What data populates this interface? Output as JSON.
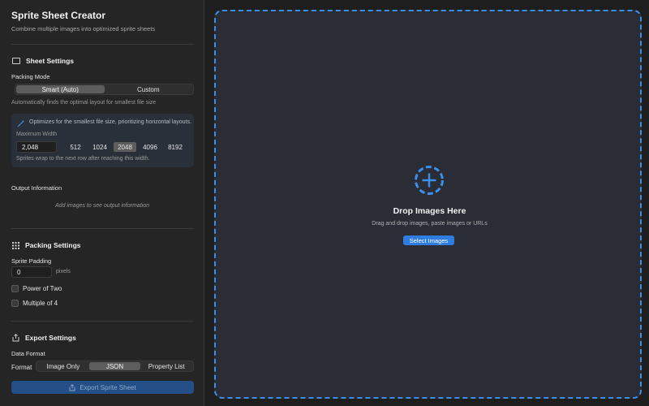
{
  "app": {
    "title": "Sprite Sheet Creator",
    "subtitle": "Combine multiple images into optimized sprite sheets"
  },
  "sheet_settings": {
    "heading": "Sheet Settings",
    "packing_mode_label": "Packing Mode",
    "modes": [
      "Smart (Auto)",
      "Custom"
    ],
    "active_mode": "Smart (Auto)",
    "mode_help": "Automatically finds the optimal layout for smallest file size",
    "info_text": "Optimizes for the smallest file size, prioritizing horizontal layouts.",
    "max_width_label": "Maximum Width",
    "max_width_value": "2,048",
    "width_presets": [
      "512",
      "1024",
      "2048",
      "4096",
      "8192"
    ],
    "active_width": "2048",
    "wrap_help": "Sprites wrap to the next row after reaching this width."
  },
  "output": {
    "heading": "Output Information",
    "empty_text": "Add images to see output information"
  },
  "packing_settings": {
    "heading": "Packing Settings",
    "padding_label": "Sprite Padding",
    "padding_value": "0",
    "padding_unit": "pixels",
    "power_of_two_label": "Power of Two",
    "power_of_two_checked": false,
    "multiple_of_4_label": "Multiple of 4",
    "multiple_of_4_checked": false
  },
  "export_settings": {
    "heading": "Export Settings",
    "data_format_label": "Data Format",
    "format_label": "Format",
    "formats": [
      "Image Only",
      "JSON",
      "Property List"
    ],
    "active_format": "JSON",
    "export_button": "Export Sprite Sheet"
  },
  "dropzone": {
    "title": "Drop Images Here",
    "subtitle": "Drag and drop images, paste images or URLs",
    "button": "Select Images"
  },
  "colors": {
    "accent": "#2f7de1",
    "dashed_border": "#3d8ee8",
    "sidebar_bg": "#252525",
    "main_bg": "#2a2d35"
  }
}
